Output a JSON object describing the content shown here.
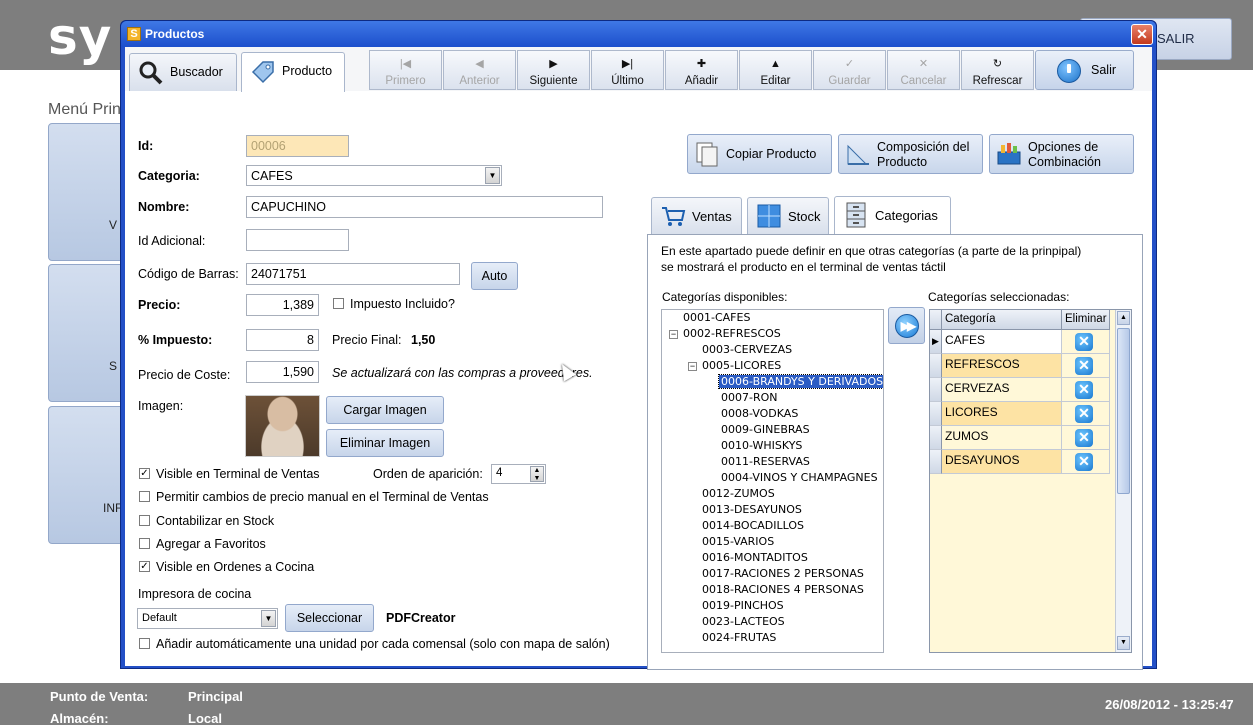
{
  "background": {
    "logo": "sy",
    "salir_label": "SALIR",
    "menu_title": "Menú Prin",
    "tiles": [
      "V",
      "S",
      "INF"
    ],
    "footer": {
      "punto_label": "Punto de Venta:",
      "punto_value": "Principal",
      "almacen_label": "Almacén:",
      "almacen_value": "Local",
      "datetime": "26/08/2012 - 13:25:47"
    }
  },
  "window": {
    "icon_letter": "S",
    "title": "Productos",
    "close_glyph": "✕"
  },
  "toolbar": {
    "tabs": [
      {
        "label": "Buscador",
        "icon": "binoculars-icon"
      },
      {
        "label": "Producto",
        "icon": "tag-icon"
      }
    ],
    "nav": [
      {
        "label": "Primero",
        "glyph": "|◀",
        "enabled": false
      },
      {
        "label": "Anterior",
        "glyph": "◀",
        "enabled": false
      },
      {
        "label": "Siguiente",
        "glyph": "▶",
        "enabled": true
      },
      {
        "label": "Último",
        "glyph": "▶|",
        "enabled": true
      },
      {
        "label": "Añadir",
        "glyph": "✚",
        "enabled": true
      },
      {
        "label": "Editar",
        "glyph": "▲",
        "enabled": true
      },
      {
        "label": "Guardar",
        "glyph": "✓",
        "enabled": false
      },
      {
        "label": "Cancelar",
        "glyph": "✕",
        "enabled": false
      },
      {
        "label": "Refrescar",
        "glyph": "↻",
        "enabled": true
      }
    ],
    "salir": "Salir"
  },
  "form": {
    "id_label": "Id:",
    "id_value": "00006",
    "categoria_label": "Categoria:",
    "categoria_value": "CAFES",
    "nombre_label": "Nombre:",
    "nombre_value": "CAPUCHINO",
    "id_adicional_label": "Id Adicional:",
    "id_adicional_value": "",
    "codigo_label": "Código de Barras:",
    "codigo_value": "24071751",
    "auto_label": "Auto",
    "precio_label": "Precio:",
    "precio_value": "1,389",
    "impuesto_incluido_label": "Impuesto Incluido?",
    "impuesto_incluido_checked": false,
    "impuesto_label": "% Impuesto:",
    "impuesto_value": "8",
    "precio_final_label": "Precio Final:",
    "precio_final_value": "1,50",
    "coste_label": "Precio de Coste:",
    "coste_value": "1,590",
    "coste_note": "Se actualizará con las compras a proveedores.",
    "imagen_label": "Imagen:",
    "cargar_label": "Cargar Imagen",
    "eliminar_label": "Eliminar Imagen",
    "checkboxes": [
      {
        "label": "Visible en Terminal de Ventas",
        "checked": true
      },
      {
        "label": "Permitir cambios de precio manual en el Terminal de Ventas",
        "checked": false
      },
      {
        "label": "Contabilizar en Stock",
        "checked": false
      },
      {
        "label": "Agregar a Favoritos",
        "checked": false
      },
      {
        "label": "Visible en Ordenes a Cocina",
        "checked": true
      }
    ],
    "orden_label": "Orden de aparición:",
    "orden_value": "4",
    "impresora_label": "Impresora de cocina",
    "impresora_value": "Default",
    "seleccionar_label": "Seleccionar",
    "impresora_name": "PDFCreator",
    "anadir_label": "Añadir automáticamente una unidad por cada comensal (solo con mapa de salón)",
    "anadir_checked": false
  },
  "actions": {
    "copiar": "Copiar Producto",
    "composicion_1": "Composición del",
    "composicion_2": "Producto",
    "opciones_1": "Opciones de",
    "opciones_2": "Combinación"
  },
  "subtabs": [
    "Ventas",
    "Stock",
    "Categorias"
  ],
  "categorias": {
    "intro_1": "En este apartado puede definir en que otras categorías (a parte de la prinpipal)",
    "intro_2": "se mostrará el producto en el terminal de ventas táctil",
    "disponibles_label": "Categorías disponibles:",
    "seleccionadas_label": "Categorías seleccionadas:",
    "tree": [
      {
        "text": "0001-CAFES",
        "level": 0
      },
      {
        "text": "0002-REFRESCOS",
        "level": 0,
        "expander": "−"
      },
      {
        "text": "0003-CERVEZAS",
        "level": 1
      },
      {
        "text": "0005-LICORES",
        "level": 1,
        "expander": "−"
      },
      {
        "text": "0006-BRANDYS Y DERIVADOS",
        "level": 2,
        "selected": true
      },
      {
        "text": "0007-RON",
        "level": 2
      },
      {
        "text": "0008-VODKAS",
        "level": 2
      },
      {
        "text": "0009-GINEBRAS",
        "level": 2
      },
      {
        "text": "0010-WHISKYS",
        "level": 2
      },
      {
        "text": "0011-RESERVAS",
        "level": 2
      },
      {
        "text": "0004-VINOS Y CHAMPAGNES",
        "level": 2
      },
      {
        "text": "0012-ZUMOS",
        "level": 1
      },
      {
        "text": "0013-DESAYUNOS",
        "level": 1
      },
      {
        "text": "0014-BOCADILLOS",
        "level": 1
      },
      {
        "text": "0015-VARIOS",
        "level": 1
      },
      {
        "text": "0016-MONTADITOS",
        "level": 1
      },
      {
        "text": "0017-RACIONES 2 PERSONAS",
        "level": 1
      },
      {
        "text": "0018-RACIONES 4 PERSONAS",
        "level": 1
      },
      {
        "text": "0019-PINCHOS",
        "level": 1
      },
      {
        "text": "0023-LACTEOS",
        "level": 1
      },
      {
        "text": "0024-FRUTAS",
        "level": 1
      }
    ],
    "grid_headers": [
      "Categoría",
      "Eliminar"
    ],
    "grid_rows": [
      "CAFES",
      "REFRESCOS",
      "CERVEZAS",
      "LICORES",
      "ZUMOS",
      "DESAYUNOS"
    ],
    "current_row_marker": "▶",
    "move_glyph": "▶▶"
  }
}
